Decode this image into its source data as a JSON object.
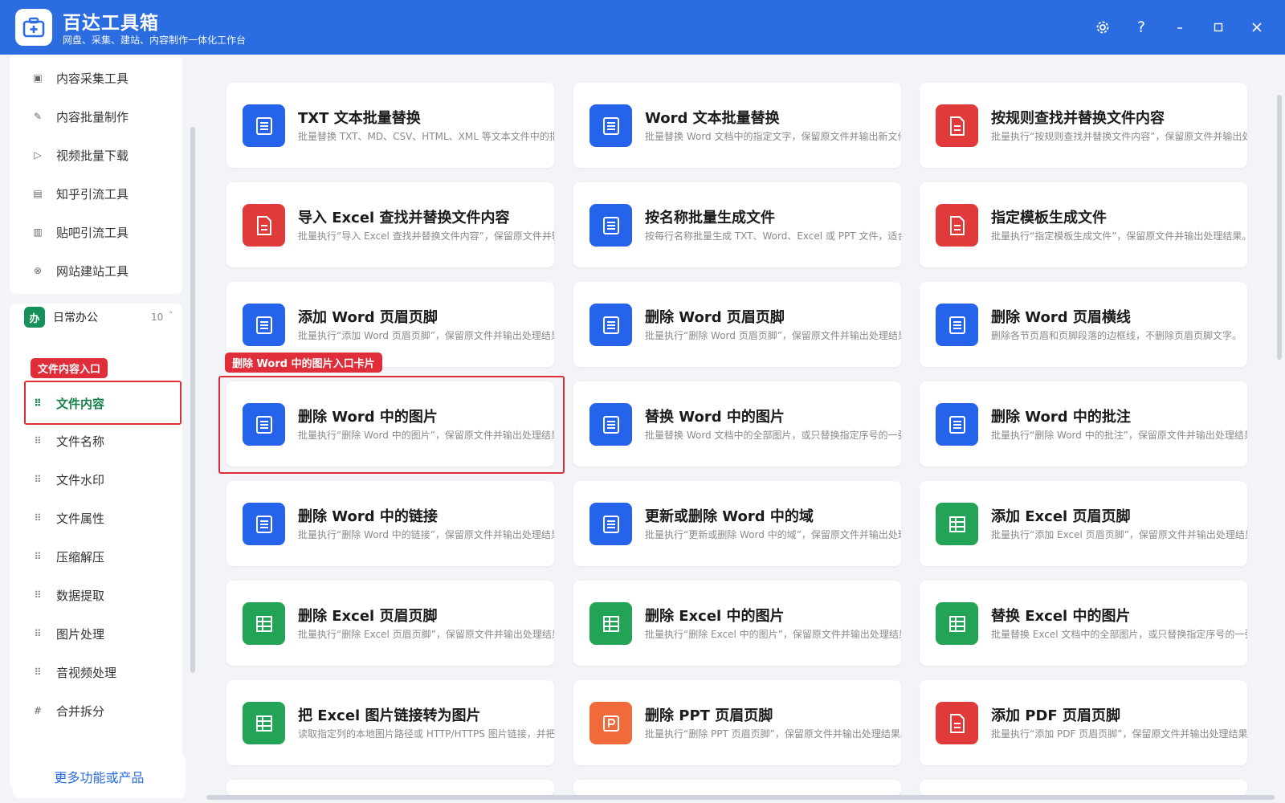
{
  "app": {
    "title": "百达工具箱",
    "subtitle": "网盘、采集、建站、内容制作一体化工作台"
  },
  "window_controls": [
    "settings-icon",
    "help-icon",
    "minimize-icon",
    "maximize-icon",
    "close-icon"
  ],
  "sidebar": {
    "top_items": [
      {
        "label": "内容采集工具",
        "icon": "collect-icon"
      },
      {
        "label": "内容批量制作",
        "icon": "edit-icon"
      },
      {
        "label": "视频批量下载",
        "icon": "video-icon"
      },
      {
        "label": "知乎引流工具",
        "icon": "zhihu-icon"
      },
      {
        "label": "贴吧引流工具",
        "icon": "tieba-icon"
      },
      {
        "label": "网站建站工具",
        "icon": "website-icon"
      }
    ],
    "group": {
      "icon_label": "办",
      "title": "日常办公",
      "count": "10",
      "caret": "˄"
    },
    "group_items": [
      {
        "label": "文件内容",
        "active": true
      },
      {
        "label": "文件名称"
      },
      {
        "label": "文件水印"
      },
      {
        "label": "文件属性"
      },
      {
        "label": "压缩解压"
      },
      {
        "label": "数据提取"
      },
      {
        "label": "图片处理"
      },
      {
        "label": "音视频处理"
      },
      {
        "label": "合并拆分"
      }
    ],
    "callout_label": "文件内容入口",
    "more_button": "更多功能或产品"
  },
  "main": {
    "card_callout": "删除 Word 中的图片入口卡片",
    "cards": [
      {
        "title": "TXT 文本批量替换",
        "desc": "批量替换 TXT、MD、CSV、HTML、XML 等文本文件中的指定内容",
        "color": "#2563eb",
        "icon": "doc-icon"
      },
      {
        "title": "Word 文本批量替换",
        "desc": "批量替换 Word 文档中的指定文字，保留原文件并输出新文件。",
        "color": "#2563eb",
        "icon": "doc-icon"
      },
      {
        "title": "按规则查找并替换文件内容",
        "desc": "批量执行“按规则查找并替换文件内容”，保留原文件并输出处理结果。",
        "color": "#e03a3a",
        "icon": "file-icon"
      },
      {
        "title": "导入 Excel 查找并替换文件内容",
        "desc": "批量执行“导入 Excel 查找并替换文件内容”，保留原文件并输出处理结果。",
        "color": "#e03a3a",
        "icon": "file-icon"
      },
      {
        "title": "按名称批量生成文件",
        "desc": "按每行名称批量生成 TXT、Word、Excel 或 PPT 文件，适合批量",
        "color": "#2563eb",
        "icon": "doc-icon"
      },
      {
        "title": "指定模板生成文件",
        "desc": "批量执行“指定模板生成文件”，保留原文件并输出处理结果。",
        "color": "#e03a3a",
        "icon": "file-icon"
      },
      {
        "title": "添加 Word 页眉页脚",
        "desc": "批量执行“添加 Word 页眉页脚”，保留原文件并输出处理结果。",
        "color": "#2563eb",
        "icon": "doc-icon"
      },
      {
        "title": "删除 Word 页眉页脚",
        "desc": "批量执行“删除 Word 页眉页脚”，保留原文件并输出处理结果。",
        "color": "#2563eb",
        "icon": "doc-icon"
      },
      {
        "title": "删除 Word 页眉横线",
        "desc": "删除各节页眉和页脚段落的边框线，不删除页眉页脚文字。",
        "color": "#2563eb",
        "icon": "doc-icon"
      },
      {
        "title": "删除 Word 中的图片",
        "desc": "批量执行“删除 Word 中的图片”，保留原文件并输出处理结果。",
        "color": "#2563eb",
        "icon": "doc-icon"
      },
      {
        "title": "替换 Word 中的图片",
        "desc": "批量替换 Word 文档中的全部图片，或只替换指定序号的一张图片",
        "color": "#2563eb",
        "icon": "doc-icon"
      },
      {
        "title": "删除 Word 中的批注",
        "desc": "批量执行“删除 Word 中的批注”，保留原文件并输出处理结果。",
        "color": "#2563eb",
        "icon": "doc-icon"
      },
      {
        "title": "删除 Word 中的链接",
        "desc": "批量执行“删除 Word 中的链接”，保留原文件并输出处理结果。",
        "color": "#2563eb",
        "icon": "doc-icon"
      },
      {
        "title": "更新或删除 Word 中的域",
        "desc": "批量执行“更新或删除 Word 中的域”，保留原文件并输出处理结果。",
        "color": "#2563eb",
        "icon": "doc-icon"
      },
      {
        "title": "添加 Excel 页眉页脚",
        "desc": "批量执行“添加 Excel 页眉页脚”，保留原文件并输出处理结果。",
        "color": "#22a355",
        "icon": "sheet-icon"
      },
      {
        "title": "删除 Excel 页眉页脚",
        "desc": "批量执行“删除 Excel 页眉页脚”，保留原文件并输出处理结果。",
        "color": "#22a355",
        "icon": "sheet-icon"
      },
      {
        "title": "删除 Excel 中的图片",
        "desc": "批量执行“删除 Excel 中的图片”，保留原文件并输出处理结果。",
        "color": "#22a355",
        "icon": "sheet-icon"
      },
      {
        "title": "替换 Excel 中的图片",
        "desc": "批量替换 Excel 文档中的全部图片，或只替换指定序号的一张图片。",
        "color": "#22a355",
        "icon": "sheet-icon"
      },
      {
        "title": "把 Excel 图片链接转为图片",
        "desc": "读取指定列的本地图片路径或 HTTP/HTTPS 图片链接，并把图片",
        "color": "#22a355",
        "icon": "sheet-icon"
      },
      {
        "title": "删除 PPT 页眉页脚",
        "desc": "批量执行“删除 PPT 页眉页脚”，保留原文件并输出处理结果。",
        "color": "#f06a3a",
        "icon": "ppt-icon"
      },
      {
        "title": "添加 PDF 页眉页脚",
        "desc": "批量执行“添加 PDF 页眉页脚”，保留原文件并输出处理结果。",
        "color": "#e03a3a",
        "icon": "file-icon"
      }
    ]
  }
}
